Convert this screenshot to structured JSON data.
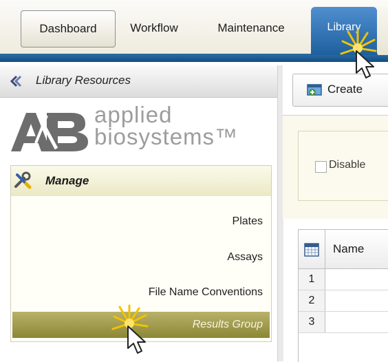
{
  "tabs": [
    {
      "label": "Dashboard"
    },
    {
      "label": "Workflow"
    },
    {
      "label": "Maintenance"
    },
    {
      "label": "Library"
    }
  ],
  "left_panel": {
    "title": "Library Resources",
    "logo": {
      "line1": "applied",
      "line2": "biosystems™"
    },
    "manage": {
      "title": "Manage",
      "items": [
        {
          "label": "Plates"
        },
        {
          "label": "Assays"
        },
        {
          "label": "File Name Conventions"
        },
        {
          "label": "Results Group"
        }
      ]
    }
  },
  "right_panel": {
    "create_label": "Create",
    "filter": {
      "checkbox_label": "Disable"
    },
    "table": {
      "column": "Name",
      "rows": [
        "1",
        "2",
        "3"
      ]
    }
  },
  "colors": {
    "active_tab": "#1e5f9e",
    "selected_item": "#8c8736",
    "manage_header": "#ebe8c6"
  }
}
